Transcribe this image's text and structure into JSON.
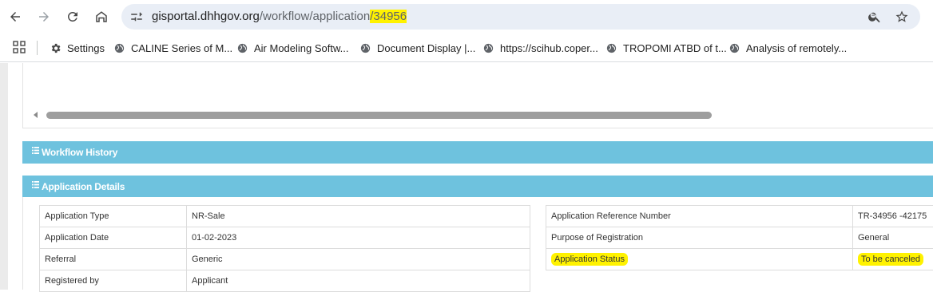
{
  "browser": {
    "url_host": "gisportal.dhhgov.org",
    "url_path": "/workflow/application",
    "url_id": "/34956"
  },
  "bookmarks": [
    {
      "label": "Settings",
      "icon": "gear-icon"
    },
    {
      "label": "CALINE Series of M...",
      "icon": "globe-icon"
    },
    {
      "label": "Air Modeling Softw...",
      "icon": "globe-icon"
    },
    {
      "label": "Document Display |...",
      "icon": "globe-icon"
    },
    {
      "label": "https://scihub.coper...",
      "icon": "globe-icon"
    },
    {
      "label": "TROPOMI ATBD of t...",
      "icon": "globe-icon"
    },
    {
      "label": "Analysis of remotely...",
      "icon": "globe-icon"
    }
  ],
  "sections": {
    "workflow_history": "Workflow History",
    "application_details": "Application Details"
  },
  "details_left": [
    {
      "label": "Application Type",
      "value": "NR-Sale"
    },
    {
      "label": "Application Date",
      "value": "01-02-2023"
    },
    {
      "label": "Referral",
      "value": "Generic"
    },
    {
      "label": "Registered by",
      "value": "Applicant"
    }
  ],
  "details_right": [
    {
      "label": "Application Reference Number",
      "value": "TR-34956 -42175"
    },
    {
      "label": "Purpose of Registration",
      "value": "General"
    },
    {
      "label": "Application Status",
      "value": "To be canceled"
    }
  ],
  "colors": {
    "section_bar": "#6ec2de",
    "highlight": "#fff200"
  }
}
